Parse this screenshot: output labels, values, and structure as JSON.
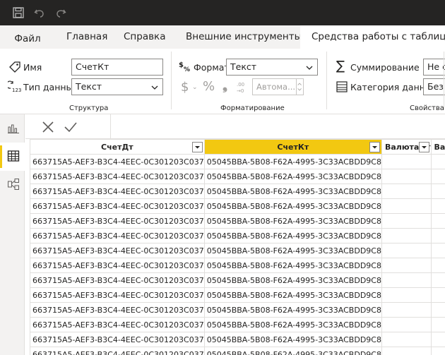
{
  "ribbon_tabs": {
    "file": "Файл",
    "home": "Главная",
    "help": "Справка",
    "external_tools": "Внешние инструменты",
    "table_tools": "Средства работы с таблицами"
  },
  "structure": {
    "name_label": "Имя",
    "name_value": "СчетКт",
    "datatype_label": "Тип данных",
    "datatype_value": "Текст",
    "group_title": "Структура"
  },
  "formatting": {
    "format_label": "Формат",
    "format_value": "Текст",
    "currency_symbol": "$",
    "percent_symbol": "%",
    "comma_symbol": "❟",
    "decimals_placeholder": "Автома...",
    "group_title": "Форматирование"
  },
  "properties": {
    "summarization_label": "Суммирование",
    "summarization_value": "Не сум",
    "category_label": "Категория данных",
    "category_value": "Без к",
    "group_title": "Свойства"
  },
  "table": {
    "columns": [
      "СчетДт",
      "СчетКт",
      "ВалютаДт",
      "ВалютаКт"
    ],
    "selected_column": "СчетКт",
    "rows": [
      [
        "663715A5-AEF3-B3C4-4EEC-0C301203C037",
        "05045BBA-5B08-F62A-4995-3C33ACBDD9C8",
        "",
        ""
      ],
      [
        "663715A5-AEF3-B3C4-4EEC-0C301203C037",
        "05045BBA-5B08-F62A-4995-3C33ACBDD9C8",
        "",
        ""
      ],
      [
        "663715A5-AEF3-B3C4-4EEC-0C301203C037",
        "05045BBA-5B08-F62A-4995-3C33ACBDD9C8",
        "",
        ""
      ],
      [
        "663715A5-AEF3-B3C4-4EEC-0C301203C037",
        "05045BBA-5B08-F62A-4995-3C33ACBDD9C8",
        "",
        ""
      ],
      [
        "663715A5-AEF3-B3C4-4EEC-0C301203C037",
        "05045BBA-5B08-F62A-4995-3C33ACBDD9C8",
        "",
        ""
      ],
      [
        "663715A5-AEF3-B3C4-4EEC-0C301203C037",
        "05045BBA-5B08-F62A-4995-3C33ACBDD9C8",
        "",
        ""
      ],
      [
        "663715A5-AEF3-B3C4-4EEC-0C301203C037",
        "05045BBA-5B08-F62A-4995-3C33ACBDD9C8",
        "",
        ""
      ],
      [
        "663715A5-AEF3-B3C4-4EEC-0C301203C037",
        "05045BBA-5B08-F62A-4995-3C33ACBDD9C8",
        "",
        ""
      ],
      [
        "663715A5-AEF3-B3C4-4EEC-0C301203C037",
        "05045BBA-5B08-F62A-4995-3C33ACBDD9C8",
        "",
        ""
      ],
      [
        "663715A5-AEF3-B3C4-4EEC-0C301203C037",
        "05045BBA-5B08-F62A-4995-3C33ACBDD9C8",
        "",
        ""
      ],
      [
        "663715A5-AEF3-B3C4-4EEC-0C301203C037",
        "05045BBA-5B08-F62A-4995-3C33ACBDD9C8",
        "",
        ""
      ],
      [
        "663715A5-AEF3-B3C4-4EEC-0C301203C037",
        "05045BBA-5B08-F62A-4995-3C33ACBDD9C8",
        "",
        ""
      ],
      [
        "663715A5-AEF3-B3C4-4EEC-0C301203C037",
        "05045BBA-5B08-F62A-4995-3C33ACBDD9C8",
        "",
        ""
      ],
      [
        "663715A5-AEF3-B3C4-4EEC-0C301203C037",
        "05045BBA-5B08-F62A-4995-3C33ACBDD9C8",
        "",
        ""
      ]
    ]
  },
  "colors": {
    "titlebar": "#252423",
    "accent_yellow": "#f2c811",
    "ribbon_bg": "#f3f2f1"
  },
  "icons": {
    "save": "save-icon",
    "undo": "undo-icon",
    "redo": "redo-icon",
    "report_view": "bar-chart-icon",
    "data_view": "table-icon",
    "model_view": "model-icon"
  }
}
